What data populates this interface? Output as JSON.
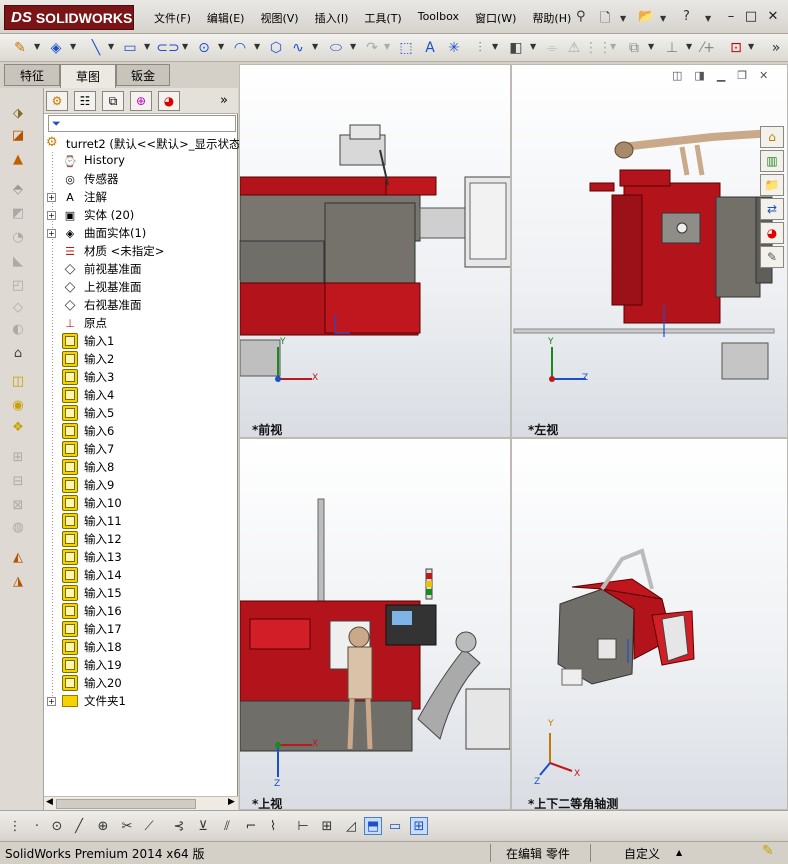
{
  "app": {
    "logo_ds": "DS",
    "logo_text": "SOLIDWORKS",
    "menus": [
      "文件(F)",
      "编辑(E)",
      "视图(V)",
      "插入(I)",
      "工具(T)",
      "Toolbox",
      "窗口(W)",
      "帮助(H)"
    ],
    "window_buttons": {
      "minimize": "–",
      "restore": "□",
      "close": "✕"
    }
  },
  "tabs": [
    "特征",
    "草图",
    "钣金"
  ],
  "tree": {
    "root": "turret2 (默认<<默认>_显示状态",
    "items": [
      {
        "label": "History",
        "icon": "history-icon",
        "expand": false
      },
      {
        "label": "传感器",
        "icon": "sensor-icon",
        "expand": false
      },
      {
        "label": "注解",
        "icon": "annotation-icon",
        "expand": true
      },
      {
        "label": "实体 (20)",
        "icon": "solid-bodies-icon",
        "expand": true
      },
      {
        "label": "曲面实体(1)",
        "icon": "surface-bodies-icon",
        "expand": true
      },
      {
        "label": "材质 <未指定>",
        "icon": "material-icon",
        "expand": false
      },
      {
        "label": "前视基准面",
        "icon": "plane-icon",
        "expand": false
      },
      {
        "label": "上视基准面",
        "icon": "plane-icon",
        "expand": false
      },
      {
        "label": "右视基准面",
        "icon": "plane-icon",
        "expand": false
      },
      {
        "label": "原点",
        "icon": "origin-icon",
        "expand": false
      },
      {
        "label": "输入1",
        "icon": "import-icon",
        "expand": false
      },
      {
        "label": "输入2",
        "icon": "import-icon",
        "expand": false
      },
      {
        "label": "输入3",
        "icon": "import-icon",
        "expand": false
      },
      {
        "label": "输入4",
        "icon": "import-icon",
        "expand": false
      },
      {
        "label": "输入5",
        "icon": "import-icon",
        "expand": false
      },
      {
        "label": "输入6",
        "icon": "import-icon",
        "expand": false
      },
      {
        "label": "输入7",
        "icon": "import-icon",
        "expand": false
      },
      {
        "label": "输入8",
        "icon": "import-icon",
        "expand": false
      },
      {
        "label": "输入9",
        "icon": "import-icon",
        "expand": false
      },
      {
        "label": "输入10",
        "icon": "import-icon",
        "expand": false
      },
      {
        "label": "输入11",
        "icon": "import-icon",
        "expand": false
      },
      {
        "label": "输入12",
        "icon": "import-icon",
        "expand": false
      },
      {
        "label": "输入13",
        "icon": "import-icon",
        "expand": false
      },
      {
        "label": "输入14",
        "icon": "import-icon",
        "expand": false
      },
      {
        "label": "输入15",
        "icon": "import-icon",
        "expand": false
      },
      {
        "label": "输入16",
        "icon": "import-icon",
        "expand": false
      },
      {
        "label": "输入17",
        "icon": "import-icon",
        "expand": false
      },
      {
        "label": "输入18",
        "icon": "import-icon",
        "expand": false
      },
      {
        "label": "输入19",
        "icon": "import-icon",
        "expand": false
      },
      {
        "label": "输入20",
        "icon": "import-icon",
        "expand": false
      },
      {
        "label": "文件夹1",
        "icon": "folder-icon",
        "expand": true
      }
    ]
  },
  "viewports": {
    "front": "*前视",
    "left": "*左视",
    "top": "*上视",
    "iso": "*上下二等角轴测"
  },
  "axes": {
    "x": "X",
    "y": "Y",
    "z": "Z"
  },
  "colors": {
    "machine_red": "#b3141c",
    "machine_gray": "#6f6e68",
    "accent_blue": "#1c4fcc"
  },
  "status": {
    "product": "SolidWorks Premium 2014 x64 版",
    "mode": "在编辑 零件",
    "custom": "自定义"
  }
}
